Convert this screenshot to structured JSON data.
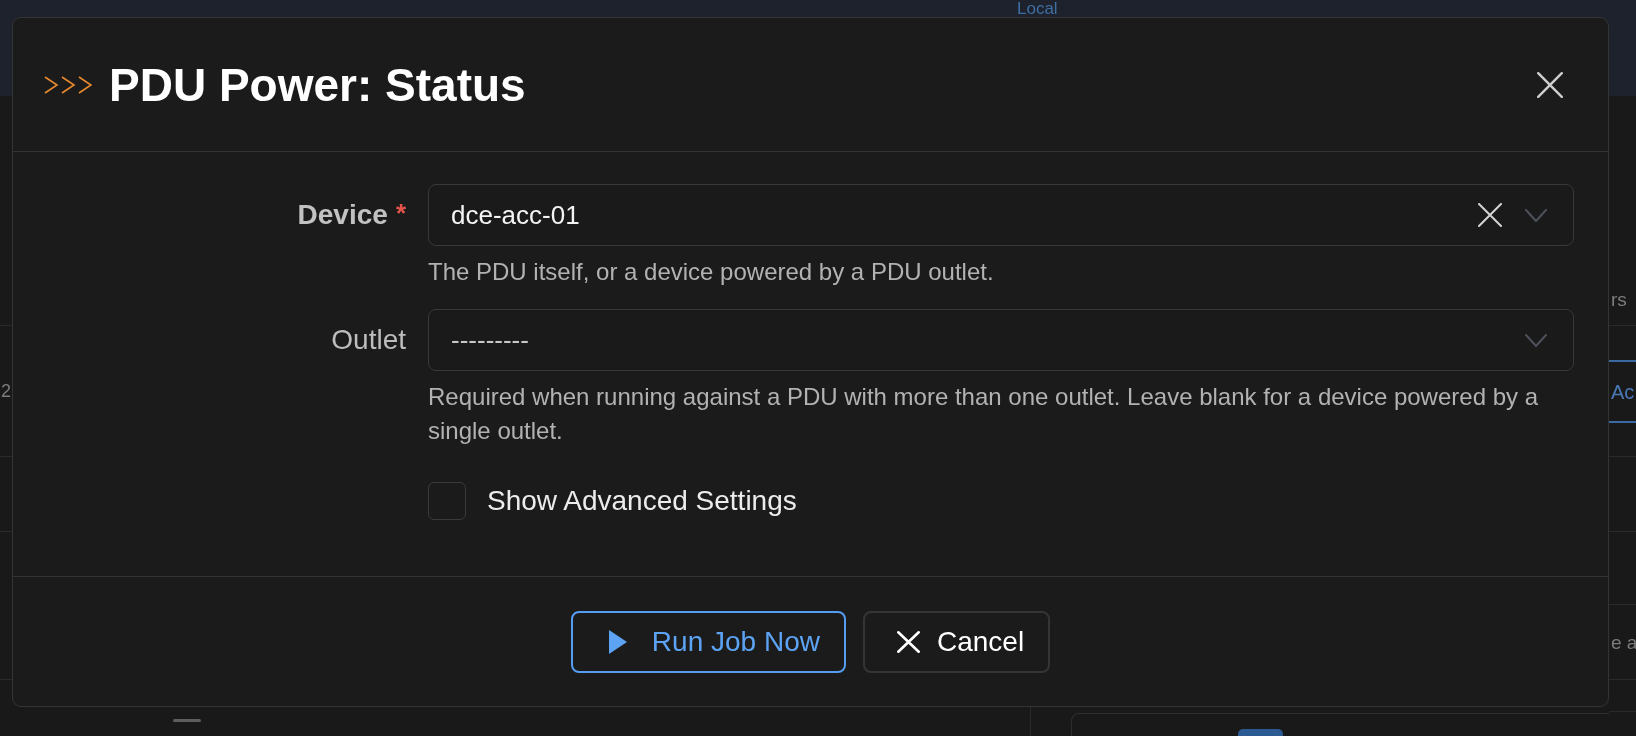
{
  "background": {
    "nav_link": "Local",
    "left_cells": [
      "2"
    ],
    "right_fragments": [
      {
        "kind": "text",
        "text": "rs"
      },
      {
        "kind": "button",
        "text": "Ac"
      },
      {
        "kind": "text",
        "text": "e a"
      }
    ]
  },
  "dialog": {
    "title": "PDU Power: Status",
    "fields": [
      {
        "label": "Device",
        "required": true,
        "required_mark": "*",
        "value": "dce-acc-01",
        "help": "The PDU itself, or a device powered by a PDU outlet."
      },
      {
        "label": "Outlet",
        "required": false,
        "placeholder": "---------",
        "help": "Required when running against a PDU with more than one outlet. Leave blank for a device powered by a single outlet."
      }
    ],
    "checkbox": {
      "label": "Show Advanced Settings",
      "checked": false
    },
    "buttons": [
      {
        "kind": "primary",
        "label": "Run Job Now"
      },
      {
        "kind": "secondary",
        "label": "Cancel"
      }
    ]
  }
}
